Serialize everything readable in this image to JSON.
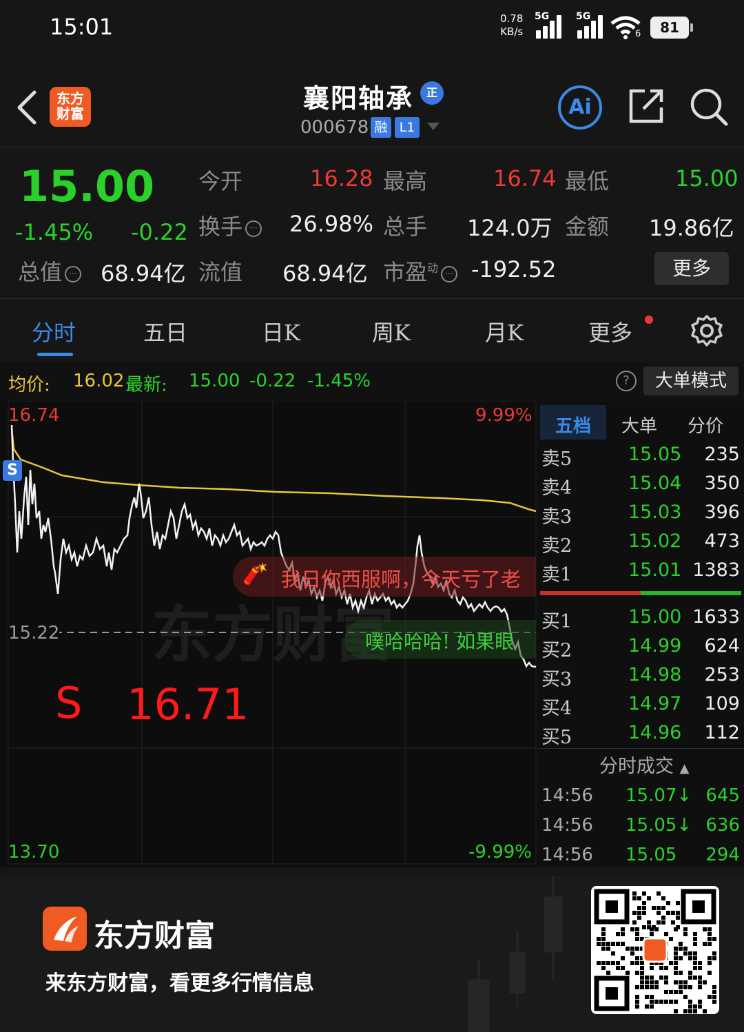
{
  "status": {
    "time": "15:01",
    "netspeed_value": "0.78",
    "netspeed_unit": "KB/s",
    "sig1_label": "5G",
    "sig2_label": "5G",
    "wifi_sub": "6",
    "battery": "81"
  },
  "header": {
    "logo_text_1": "东方",
    "logo_text_2": "财富",
    "stock_name": "襄阳轴承",
    "zheng": "正",
    "stock_code": "000678",
    "rong": "融",
    "l1": "L1",
    "ai": "Ai"
  },
  "quote": {
    "price": "15.00",
    "change_pct": "-1.45%",
    "change": "-0.22",
    "open_label": "今开",
    "open": "16.28",
    "high_label": "最高",
    "high": "16.74",
    "low_label": "最低",
    "low": "15.00",
    "turnover_label": "换手",
    "turnover": "26.98%",
    "volume_label": "总手",
    "volume": "124.0万",
    "amount_label": "金额",
    "amount": "19.86亿",
    "mktcap_label": "总值",
    "mktcap": "68.94亿",
    "float_label": "流值",
    "float": "68.94亿",
    "pe_label": "市盈",
    "pe_sup": "动",
    "pe": "-192.52",
    "more": "更多"
  },
  "tabs": [
    "分时",
    "五日",
    "日K",
    "周K",
    "月K",
    "更多"
  ],
  "chart_head": {
    "avg_label": "均价:",
    "avg": "16.02",
    "latest_label": "最新:",
    "latest": "15.00",
    "change": "-0.22",
    "pct": "-1.45%",
    "big_order": "大单模式",
    "help": "?"
  },
  "chart": {
    "top_price": "16.74",
    "top_pct": "9.99%",
    "mid_price": "15.22",
    "bottom_price": "13.70",
    "bottom_pct": "-9.99%",
    "s_marker": "S",
    "s_label": "S",
    "s_price": "16.71",
    "watermark": "东方财富",
    "danmaku_1": "我日你西服啊，今天亏了老",
    "danmaku_2": "噗哈哈哈! 如果眼"
  },
  "book_tabs": [
    "五档",
    "大单",
    "分价"
  ],
  "sell": [
    {
      "label": "卖5",
      "price": "15.05",
      "vol": "235"
    },
    {
      "label": "卖4",
      "price": "15.04",
      "vol": "350"
    },
    {
      "label": "卖3",
      "price": "15.03",
      "vol": "396"
    },
    {
      "label": "卖2",
      "price": "15.02",
      "vol": "473"
    },
    {
      "label": "卖1",
      "price": "15.01",
      "vol": "1383"
    }
  ],
  "buy": [
    {
      "label": "买1",
      "price": "15.00",
      "vol": "1633"
    },
    {
      "label": "买2",
      "price": "14.99",
      "vol": "624"
    },
    {
      "label": "买3",
      "price": "14.98",
      "vol": "253"
    },
    {
      "label": "买4",
      "price": "14.97",
      "vol": "109"
    },
    {
      "label": "买5",
      "price": "14.96",
      "vol": "112"
    }
  ],
  "trades_title": "分时成交",
  "trades": [
    {
      "time": "14:56",
      "price": "15.07↓",
      "vol": "645"
    },
    {
      "time": "14:56",
      "price": "15.05↓",
      "vol": "636"
    },
    {
      "time": "14:56",
      "price": "15.05",
      "vol": "294"
    }
  ],
  "footer": {
    "brand": "东方财富",
    "slogan": "来东方财富，看更多行情信息"
  },
  "colors": {
    "up": "#ea3a35",
    "down": "#2bd12b",
    "accent": "#3a8be8",
    "avg_line": "#e8c63a",
    "brand": "#ef5b23"
  },
  "icons": [
    "back-icon",
    "share-icon",
    "search-icon",
    "gear-icon",
    "help-icon",
    "qr-code"
  ]
}
